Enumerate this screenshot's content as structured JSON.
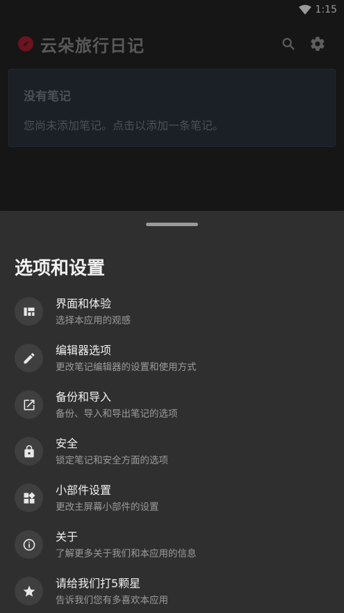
{
  "status": {
    "time": "1:15",
    "wifi_icon": "wifi-icon"
  },
  "app_bar": {
    "title": "云朵旅行日记",
    "logo_color": "#6b1320",
    "actions": [
      "search-icon",
      "settings-icon"
    ]
  },
  "empty_state": {
    "title": "没有笔记",
    "message": "您尚未添加笔记。点击以添加一条笔记。"
  },
  "sheet": {
    "title": "选项和设置",
    "items": [
      {
        "icon": "dashboard-icon",
        "label": "界面和体验",
        "subtitle": "选择本应用的观感"
      },
      {
        "icon": "pencil-icon",
        "label": "编辑器选项",
        "subtitle": "更改笔记编辑器的设置和使用方式"
      },
      {
        "icon": "open-external-icon",
        "label": "备份和导入",
        "subtitle": "备份、导入和导出笔记的选项"
      },
      {
        "icon": "lock-icon",
        "label": "安全",
        "subtitle": "锁定笔记和安全方面的选项"
      },
      {
        "icon": "widgets-icon",
        "label": "小部件设置",
        "subtitle": "更改主屏幕小部件的设置"
      },
      {
        "icon": "info-icon",
        "label": "关于",
        "subtitle": "了解更多关于我们和本应用的信息"
      },
      {
        "icon": "star-icon",
        "label": "请给我们打5颗星",
        "subtitle": "告诉我们您有多喜欢本应用"
      }
    ]
  }
}
